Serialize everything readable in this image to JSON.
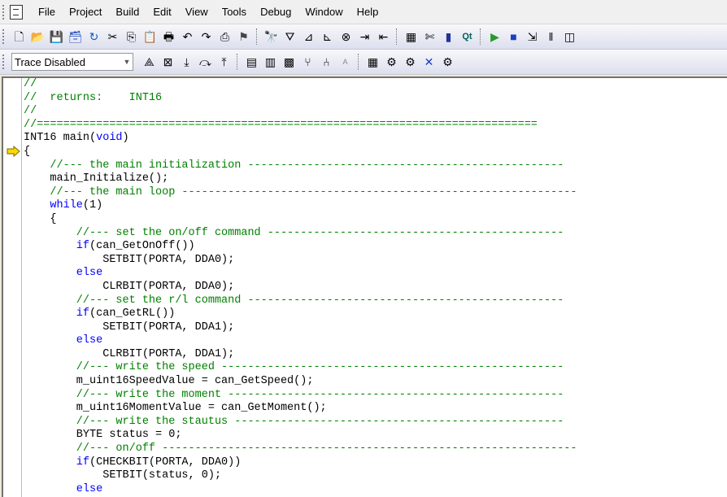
{
  "menu": {
    "items": [
      "File",
      "Project",
      "Build",
      "Edit",
      "View",
      "Tools",
      "Debug",
      "Window",
      "Help"
    ]
  },
  "toolbar1": {
    "icons": [
      "new-file-icon",
      "open-folder-icon",
      "save-icon",
      "save-all-icon",
      "refresh-icon",
      "cut-icon",
      "copy-icon",
      "paste-icon",
      "print-icon",
      "undo-icon",
      "redo-icon",
      "find-in-files-icon",
      "flag-icon",
      "binoculars-icon",
      "bookmark-icon",
      "next-bookmark-icon",
      "prev-bookmark-icon",
      "clear-bookmarks-icon",
      "indent-icon",
      "outdent-icon",
      "board-icon",
      "scissors-tool-icon",
      "memory-icon",
      "qt-icon",
      "run-icon",
      "stop-icon",
      "step-icon",
      "pause-icon",
      "window-icon"
    ]
  },
  "toolbar2": {
    "trace_select": "Trace Disabled",
    "icons": [
      "breakpoint-icon",
      "clear-breakpoint-icon",
      "step-into-icon",
      "step-over-icon",
      "step-out-icon",
      "chip-icon",
      "emulator-icon",
      "processor-icon",
      "connect-icon",
      "disconnect-icon",
      "auto-icon",
      "calculator-icon",
      "settings-icon",
      "cog-icon",
      "close-x-icon",
      "gear-icon"
    ]
  },
  "editor": {
    "lines": [
      [
        {
          "c": "cm",
          "t": "//"
        }
      ],
      [
        {
          "c": "cm",
          "t": "//  returns:    INT16"
        }
      ],
      [
        {
          "c": "cm",
          "t": "//"
        }
      ],
      [
        {
          "c": "cm",
          "t": "//============================================================================"
        }
      ],
      [
        {
          "c": "tx",
          "t": "INT16 main("
        },
        {
          "c": "kw",
          "t": "void"
        },
        {
          "c": "tx",
          "t": ")"
        }
      ],
      [
        {
          "c": "tx",
          "t": "{"
        }
      ],
      [
        {
          "c": "cm",
          "t": "    //--- the main initialization ------------------------------------------------"
        }
      ],
      [
        {
          "c": "tx",
          "t": "    main_Initialize();"
        }
      ],
      [
        {
          "c": "cm",
          "t": "    //--- the main loop ------------------------------------------------------------"
        }
      ],
      [
        {
          "c": "kw",
          "t": "    while"
        },
        {
          "c": "tx",
          "t": "(1)"
        }
      ],
      [
        {
          "c": "tx",
          "t": "    {"
        }
      ],
      [
        {
          "c": "cm",
          "t": "        //--- set the on/off command ---------------------------------------------"
        }
      ],
      [
        {
          "c": "kw",
          "t": "        if"
        },
        {
          "c": "tx",
          "t": "(can_GetOnOff())"
        }
      ],
      [
        {
          "c": "tx",
          "t": "            SETBIT(PORTA, DDA0);"
        }
      ],
      [
        {
          "c": "kw",
          "t": "        else"
        }
      ],
      [
        {
          "c": "tx",
          "t": "            CLRBIT(PORTA, DDA0);"
        }
      ],
      [
        {
          "c": "cm",
          "t": "        //--- set the r/l command ------------------------------------------------"
        }
      ],
      [
        {
          "c": "kw",
          "t": "        if"
        },
        {
          "c": "tx",
          "t": "(can_GetRL())"
        }
      ],
      [
        {
          "c": "tx",
          "t": "            SETBIT(PORTA, DDA1);"
        }
      ],
      [
        {
          "c": "kw",
          "t": "        else"
        }
      ],
      [
        {
          "c": "tx",
          "t": "            CLRBIT(PORTA, DDA1);"
        }
      ],
      [
        {
          "c": "cm",
          "t": "        //--- write the speed ----------------------------------------------------"
        }
      ],
      [
        {
          "c": "tx",
          "t": "        m_uint16SpeedValue = can_GetSpeed();"
        }
      ],
      [
        {
          "c": "cm",
          "t": "        //--- write the moment ---------------------------------------------------"
        }
      ],
      [
        {
          "c": "tx",
          "t": "        m_uint16MomentValue = can_GetMoment();"
        }
      ],
      [
        {
          "c": "cm",
          "t": "        //--- write the stautus --------------------------------------------------"
        }
      ],
      [
        {
          "c": "tx",
          "t": "        BYTE status = 0;"
        }
      ],
      [
        {
          "c": "cm",
          "t": "        //--- on/off ---------------------------------------------------------------"
        }
      ],
      [
        {
          "c": "kw",
          "t": "        if"
        },
        {
          "c": "tx",
          "t": "(CHECKBIT(PORTA, DDA0))"
        }
      ],
      [
        {
          "c": "tx",
          "t": "            SETBIT(status, 0);"
        }
      ],
      [
        {
          "c": "kw",
          "t": "        else"
        }
      ]
    ]
  },
  "colors": {
    "comment": "#008000",
    "keyword": "#0000ff",
    "text": "#000000",
    "arrow": "#ffd800"
  }
}
